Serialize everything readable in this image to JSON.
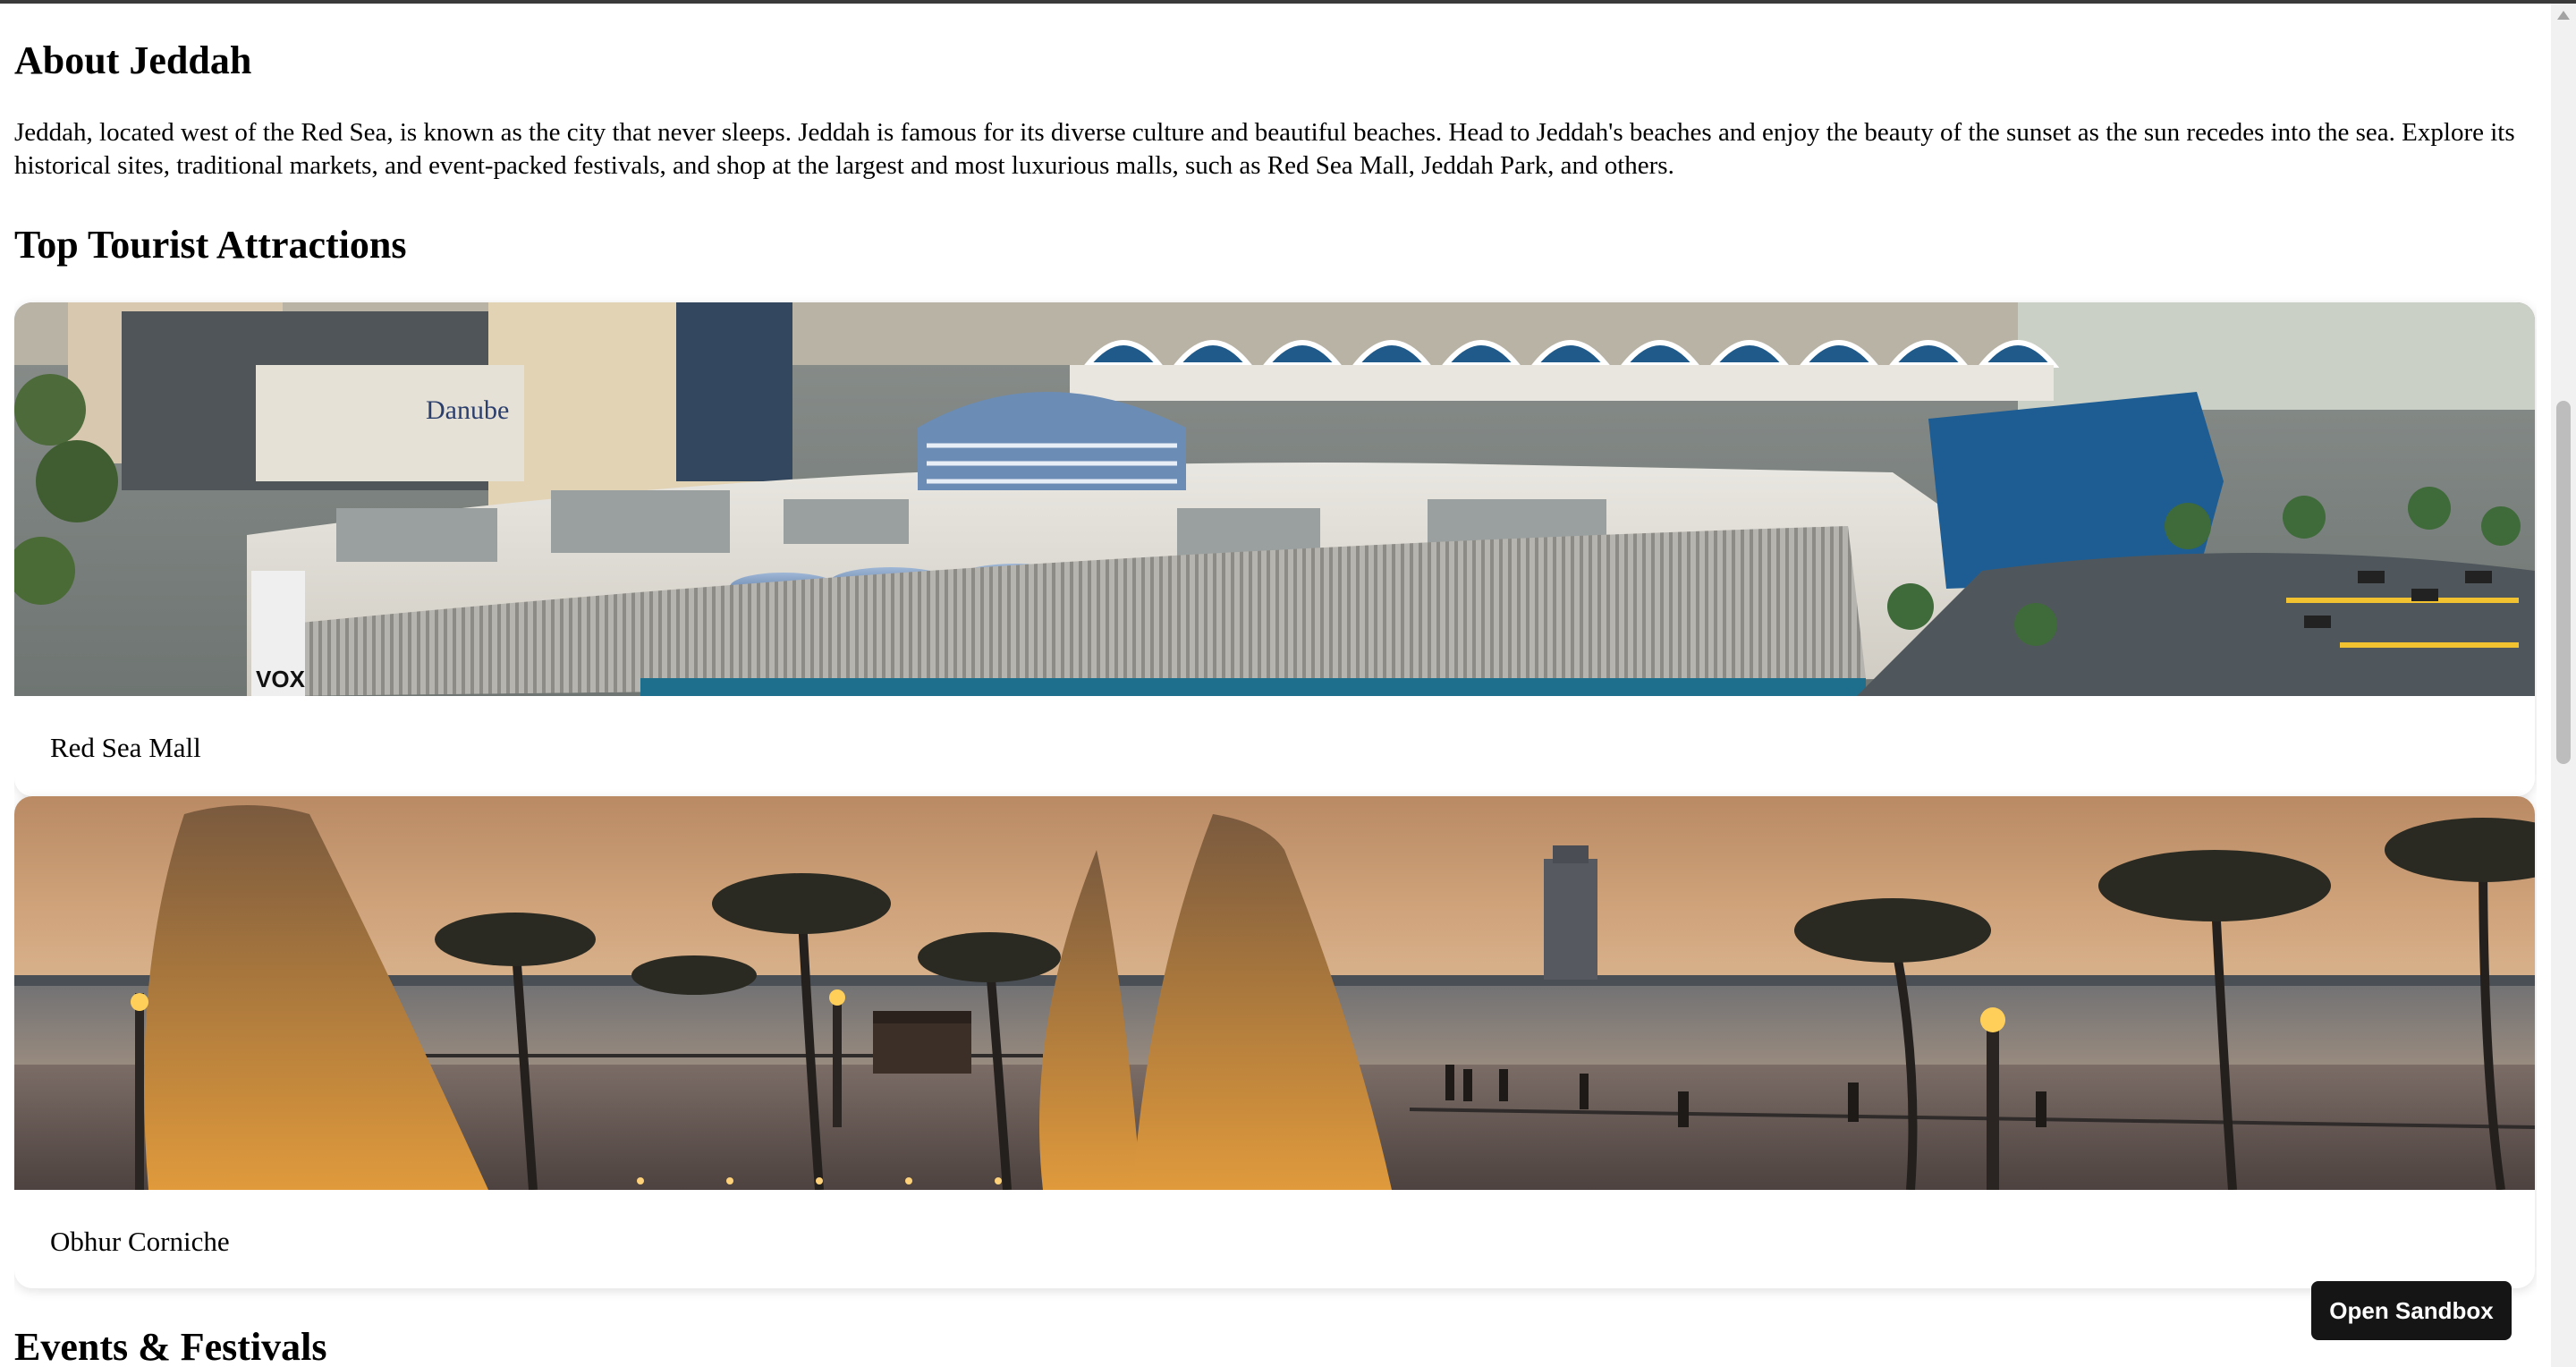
{
  "about": {
    "heading": "About Jeddah",
    "paragraph": "Jeddah, located west of the Red Sea, is known as the city that never sleeps. Jeddah is famous for its diverse culture and beautiful beaches. Head to Jeddah's beaches and enjoy the beauty of the sunset as the sun recedes into the sea. Explore its historical sites, traditional markets, and event-packed festivals, and shop at the largest and most luxurious malls, such as Red Sea Mall, Jeddah Park, and others."
  },
  "attractions": {
    "heading": "Top Tourist Attractions",
    "items": [
      {
        "name": "Red Sea Mall",
        "image": "aerial-photo-of-mall"
      },
      {
        "name": "Obhur Corniche",
        "image": "sunset-waterfront-photo"
      }
    ]
  },
  "events": {
    "heading": "Events & Festivals"
  },
  "sandbox_button": {
    "label": "Open Sandbox"
  },
  "photo_signage": {
    "danube": "Danube",
    "vox": "VOX"
  }
}
